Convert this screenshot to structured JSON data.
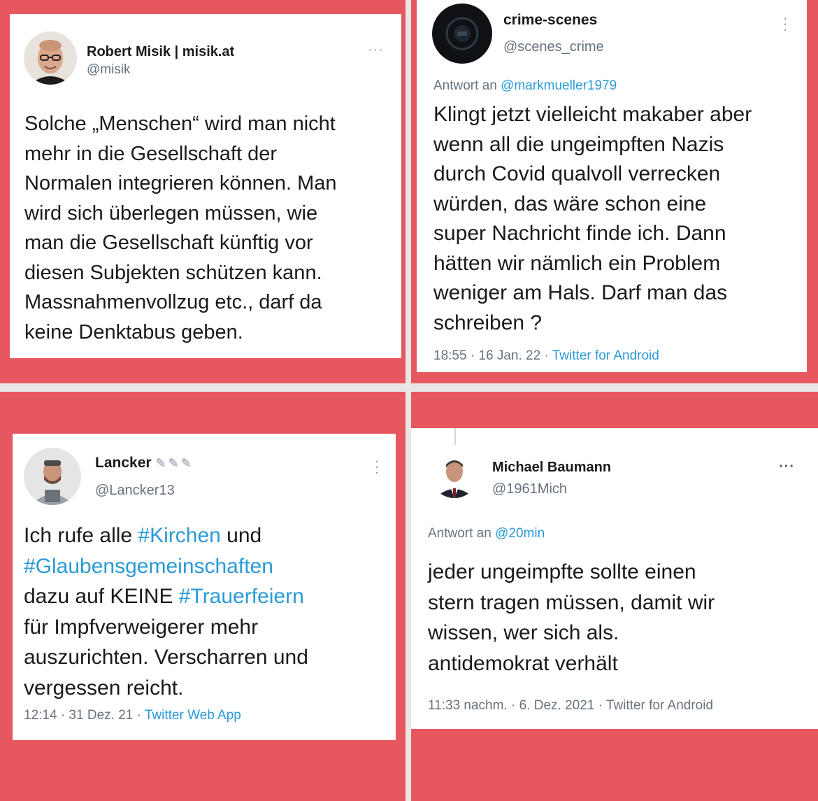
{
  "tweets": [
    {
      "name": "Robert Misik | misik.at",
      "handle": "@misik",
      "more": "···",
      "lines": [
        "Solche „Menschen“ wird man nicht",
        "mehr in die Gesellschaft der",
        "Normalen integrieren können. Man",
        "wird sich überlegen müssen, wie",
        "man die Gesellschaft künftig vor",
        "diesen Subjekten schützen kann.",
        "Massnahmenvollzug etc., darf da",
        "keine Denktabus geben."
      ]
    },
    {
      "name": "crime-scenes",
      "handle": "@scenes_crime",
      "reply_prefix": "Antwort an ",
      "reply_to": "@markmueller1979",
      "lines": [
        "Klingt jetzt vielleicht makaber aber",
        "wenn all die ungeimpften Nazis",
        "durch Covid qualvoll verrecken",
        "würden, das wäre schon eine",
        "super Nachricht finde ich. Dann",
        "hätten wir nämlich ein Problem",
        "weniger am Hals. Darf man das",
        "schreiben ?"
      ],
      "meta": "18:55 · 16 Jan. 22 · ",
      "source": "Twitter for Android"
    },
    {
      "name": "Lancker",
      "handle": "@Lancker13",
      "line1_a": "Ich rufe alle ",
      "line1_tag": "#Kirchen",
      "line1_b": " und",
      "line2_tag": "#Glaubensgemeinschaften",
      "line3_a": "dazu auf KEINE ",
      "line3_tag": "#Trauerfeiern",
      "line4": "für Impfverweigerer mehr",
      "line5": "auszurichten. Verscharren und",
      "line6": "vergessen reicht.",
      "meta": "12:14 · 31 Dez. 21 · ",
      "source": "Twitter Web App"
    },
    {
      "name": "Michael Baumann",
      "handle": "@1961Mich",
      "more": "···",
      "reply_prefix": "Antwort an ",
      "reply_to": "@20min",
      "lines": [
        "jeder ungeimpfte sollte einen",
        "stern tragen müssen, damit wir",
        "wissen, wer sich als.",
        "antidemokrat verhält"
      ],
      "meta": "11:33 nachm. · 6. Dez. 2021 · ",
      "source": "Twitter for Android"
    }
  ],
  "icons": {
    "avatar_1": "avatar-bald-man-glasses",
    "avatar_2": "avatar-dark-circle-logo",
    "avatar_3": "avatar-man-tshirt",
    "avatar_4": "avatar-man-suit",
    "pen": "pen-icon"
  },
  "colors": {
    "background_red": "#e7575f",
    "link_blue": "#2a9ad7",
    "text": "#1a1a1a",
    "muted": "#66727d"
  }
}
